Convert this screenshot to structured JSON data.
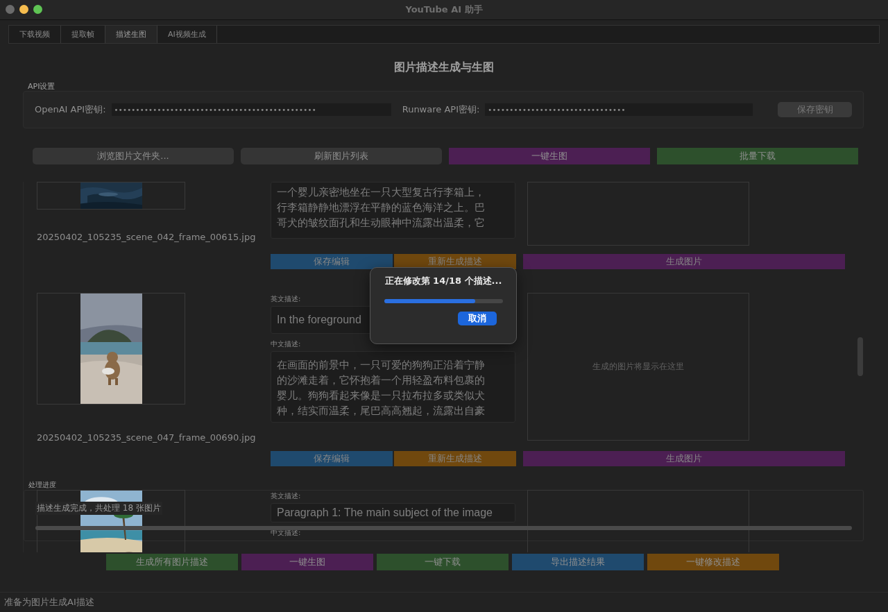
{
  "window": {
    "title": "YouTube AI 助手"
  },
  "tabs": [
    {
      "label": "下载视频",
      "selected": false
    },
    {
      "label": "提取帧",
      "selected": false
    },
    {
      "label": "描述生图",
      "selected": true
    },
    {
      "label": "AI视频生成",
      "selected": false
    }
  ],
  "heading": "图片描述生成与生图",
  "api_settings": {
    "title": "API设置",
    "openai_label": "OpenAI API密钥:",
    "openai_value": "•••••••••••••••••••••••••••••••••••••••••••••••",
    "runware_label": "Runware API密钥:",
    "runware_value": "••••••••••••••••••••••••••••••••",
    "save_button": "保存密钥"
  },
  "actions": [
    {
      "label": "浏览图片文件夹...",
      "kind": "plain"
    },
    {
      "label": "刷新图片列表",
      "kind": "plain"
    },
    {
      "label": "一键生图",
      "kind": "purple"
    },
    {
      "label": "批量下载",
      "kind": "green"
    }
  ],
  "items": [
    {
      "filename": "20250402_105235_scene_042_frame_00615.jpg",
      "cn_lines": [
        "一个婴儿亲密地坐在一只大型复古行李箱上，",
        "行李箱静静地漂浮在平静的蓝色海洋之上。巴",
        "哥犬的皱纹面孔和生动眼神中流露出温柔，它"
      ],
      "buttons": [
        "保存编辑",
        "重新生成描述",
        "生成图片"
      ]
    },
    {
      "filename": "20250402_105235_scene_047_frame_00690.jpg",
      "en_label": "英文描述:",
      "en_text": "In the foreground",
      "cn_label": "中文描述:",
      "cn_lines": [
        "在画面的前景中，一只可爱的狗狗正沿着宁静",
        "的沙滩走着，它怀抱着一个用轻盈布料包裹的",
        "婴儿。狗狗看起来像是一只拉布拉多或类似犬",
        "种，结实而温柔，尾巴高高翘起，流露出自豪"
      ],
      "preview_placeholder": "生成的图片将显示在这里",
      "buttons": [
        "保存编辑",
        "重新生成描述",
        "生成图片"
      ]
    },
    {
      "en_label": "英文描述:",
      "en_text": "Paragraph 1: The main subject of the image",
      "cn_label": "中文描述:"
    }
  ],
  "progress": {
    "title": "处理进度",
    "message": "描述生成完成，共处理 18 张图片",
    "level": 1
  },
  "bottom_buttons": [
    {
      "label": "生成所有图片描述",
      "kind": "green"
    },
    {
      "label": "一键生图",
      "kind": "purple"
    },
    {
      "label": "一键下载",
      "kind": "green"
    },
    {
      "label": "导出描述结果",
      "kind": "blue"
    },
    {
      "label": "一键修改描述",
      "kind": "orange"
    }
  ],
  "dialog": {
    "message": "正在修改第 14/18 个描述...",
    "level": 0.77,
    "cancel": "取消"
  },
  "status_bar": "准备为图片生成AI描述"
}
